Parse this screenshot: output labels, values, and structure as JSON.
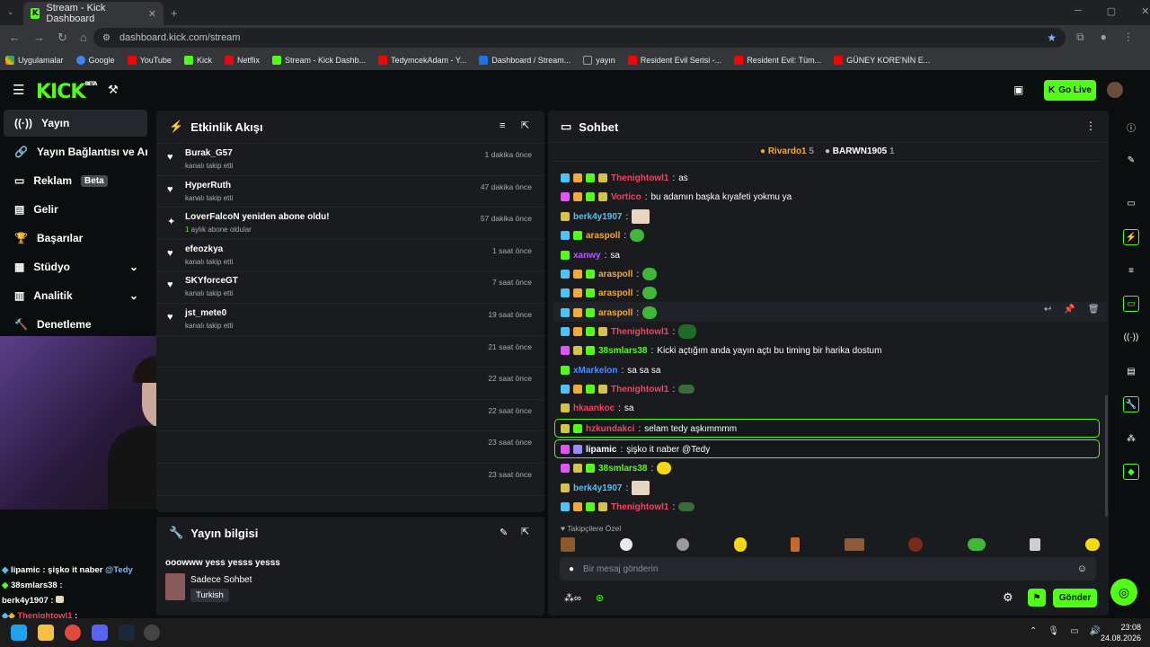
{
  "browser": {
    "tab_title": "Stream - Kick Dashboard",
    "url": "dashboard.kick.com/stream",
    "bookmarks": [
      "Uygulamalar",
      "Google",
      "YouTube",
      "Kick",
      "Netflix",
      "Stream - Kick Dashb...",
      "TedymcekAdam - Y...",
      "Dashboard / Stream...",
      "yayın",
      "Resident Evil Serisi -...",
      "Resident Evil: Tüm...",
      "GÜNEY KORE'NİN E..."
    ]
  },
  "header": {
    "logo": "KICK",
    "logo_beta": "BETA",
    "go_live": "Go Live"
  },
  "sidebar": {
    "items": [
      {
        "label": "Yayın"
      },
      {
        "label": "Yayın Bağlantısı ve Anahtarı"
      },
      {
        "label": "Reklam",
        "badge": "Beta"
      },
      {
        "label": "Gelir"
      },
      {
        "label": "Başarılar"
      },
      {
        "label": "Stüdyo"
      },
      {
        "label": "Analitik"
      },
      {
        "label": "Denetleme"
      }
    ]
  },
  "activity": {
    "title": "Etkinlik Akışı",
    "items": [
      {
        "name": "Burak_G57",
        "sub": "kanalı takip etti",
        "time": "1 dakika önce"
      },
      {
        "name": "HyperRuth",
        "sub": "kanalı takip etti",
        "time": "47 dakika önce"
      },
      {
        "name": "LoverFalcoN yeniden abone oldu!",
        "sub_num": "1",
        "sub": " aylık abone oldular",
        "time": "57 dakika önce"
      },
      {
        "name": "efeozkya",
        "sub": "kanalı takip etti",
        "time": "1 saat önce"
      },
      {
        "name": "SKYforceGT",
        "sub": "kanalı takip etti",
        "time": "7 saat önce"
      },
      {
        "name": "jst_mete0",
        "sub": "kanalı takip etti",
        "time": "19 saat önce"
      },
      {
        "time": "21 saat önce"
      },
      {
        "time": "22 saat önce"
      },
      {
        "time": "22 saat önce"
      },
      {
        "time": "23 saat önce"
      },
      {
        "time": "23 saat önce"
      }
    ]
  },
  "stream_info": {
    "title": "Yayın bilgisi",
    "stream_title": "ooowww yess yesss yesss",
    "mode": "Sadece Sohbet",
    "tag": "Turkish"
  },
  "chat": {
    "title": "Sohbet",
    "leaders": [
      {
        "name": "Rivardo1",
        "count": "5"
      },
      {
        "name": "BARWN1905",
        "count": "1"
      }
    ],
    "messages": [
      {
        "user": "Thenightowl1",
        "text": "as",
        "color": "#ff3f5e"
      },
      {
        "user": "Vortico",
        "text": "bu adamın başka kıyafeti yokmu ya",
        "color": "#ff3f5e"
      },
      {
        "user": "berk4y1907",
        "text": "",
        "color": "#4fc3f7"
      },
      {
        "user": "araspoll",
        "text": "",
        "color": "#f2a93b"
      },
      {
        "user": "xanwy",
        "text": "sa",
        "color": "#b45cff"
      },
      {
        "user": "araspoll",
        "text": "",
        "color": "#f2a93b"
      },
      {
        "user": "araspoll",
        "text": "",
        "color": "#f2a93b"
      },
      {
        "user": "araspoll",
        "text": "",
        "color": "#f2a93b"
      },
      {
        "user": "Thenightowl1",
        "text": "",
        "color": "#ff3f5e"
      },
      {
        "user": "38smlars38",
        "text": "Kicki açtığım anda yayın açtı bu timing bir harika dostum",
        "color": "#53fc18"
      },
      {
        "user": "xMarkelon",
        "text": "sa sa sa",
        "color": "#4f8bff"
      },
      {
        "user": "Thenightowl1",
        "text": "",
        "color": "#ff3f5e"
      },
      {
        "user": "hkaankoc",
        "text": "sa",
        "color": "#ff3f5e"
      },
      {
        "user": "hzkundakci",
        "text": "selam tedy aşkımmmm",
        "color": "#ff3f5e"
      },
      {
        "user": "lipamic",
        "text": "şişko it naber @Tedy",
        "color": "#ffffff"
      },
      {
        "user": "38smlars38",
        "text": "",
        "color": "#53fc18"
      },
      {
        "user": "berk4y1907",
        "text": "",
        "color": "#4fc3f7"
      },
      {
        "user": "Thenightowl1",
        "text": "",
        "color": "#ff3f5e"
      }
    ],
    "followers_label": "Takipçilere Özel",
    "input_placeholder": "Bir mesaj gönderin",
    "send": "Gönder"
  },
  "overlay": {
    "lines": [
      {
        "user": "lipamic",
        "sep": ":",
        "text": "şişko it naber",
        "mention": "@Tedy"
      },
      {
        "user": "38smlars38",
        "sep": ":",
        "text": ""
      },
      {
        "user": "berk4y1907",
        "sep": ":",
        "text": ""
      },
      {
        "user": "Thenightowl1",
        "sep": ":",
        "text": ""
      }
    ]
  },
  "taskbar": {
    "time": "23:08",
    "date": "24.08.2026"
  },
  "colors": {
    "accent": "#53fc18",
    "bg": "#0b0e0f",
    "panel": "#191b1f"
  }
}
